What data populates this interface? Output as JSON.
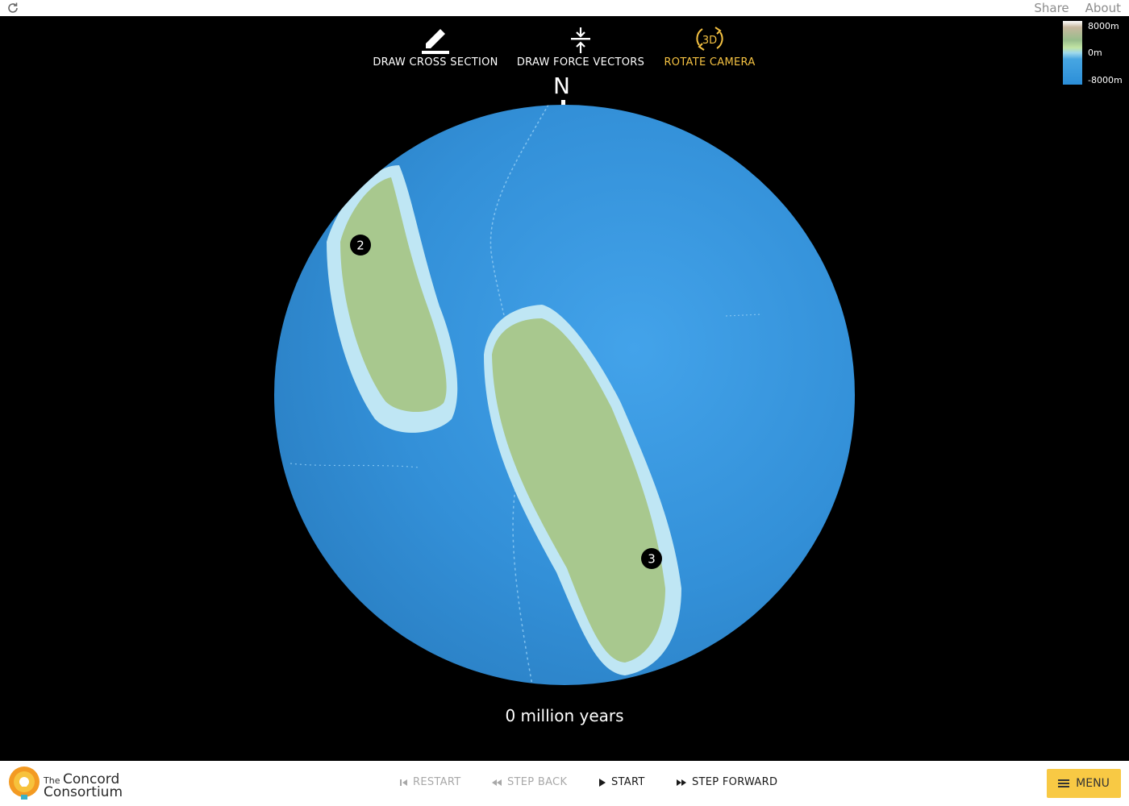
{
  "topbar": {
    "links": [
      "Share",
      "About"
    ]
  },
  "tools": [
    {
      "label": "DRAW CROSS SECTION",
      "icon": "pencil-icon",
      "active": false
    },
    {
      "label": "DRAW FORCE VECTORS",
      "icon": "compress-arrows-icon",
      "active": false
    },
    {
      "label": "ROTATE CAMERA",
      "icon": "rotate-3d-icon",
      "active": true,
      "badge": "3D"
    }
  ],
  "legend": {
    "ticks": [
      "8000m",
      "0m",
      "-8000m"
    ],
    "colors": [
      "#ffffff",
      "#c7b89e",
      "#98bd8c",
      "#c2e4a4",
      "#9fd9ec",
      "#47a6e2",
      "#2b8ed8"
    ]
  },
  "globe": {
    "north_label": "N",
    "plates": [
      {
        "label": "2"
      },
      {
        "label": "3"
      }
    ],
    "ocean_color": "#3390d8",
    "land_color": "#a8c88e"
  },
  "time": {
    "label": "0 million years"
  },
  "logo": {
    "prefix": "The",
    "name1": "Concord",
    "name2": "Consortium"
  },
  "controls": [
    {
      "label": "RESTART",
      "enabled": false,
      "icon": "skip-back-icon"
    },
    {
      "label": "STEP BACK",
      "enabled": false,
      "icon": "rewind-icon"
    },
    {
      "label": "START",
      "enabled": true,
      "icon": "play-icon"
    },
    {
      "label": "STEP FORWARD",
      "enabled": true,
      "icon": "fast-forward-icon"
    }
  ],
  "menu": {
    "label": "MENU",
    "icon": "hamburger-icon",
    "color": "#f8c944"
  },
  "accent": "#f5c242"
}
